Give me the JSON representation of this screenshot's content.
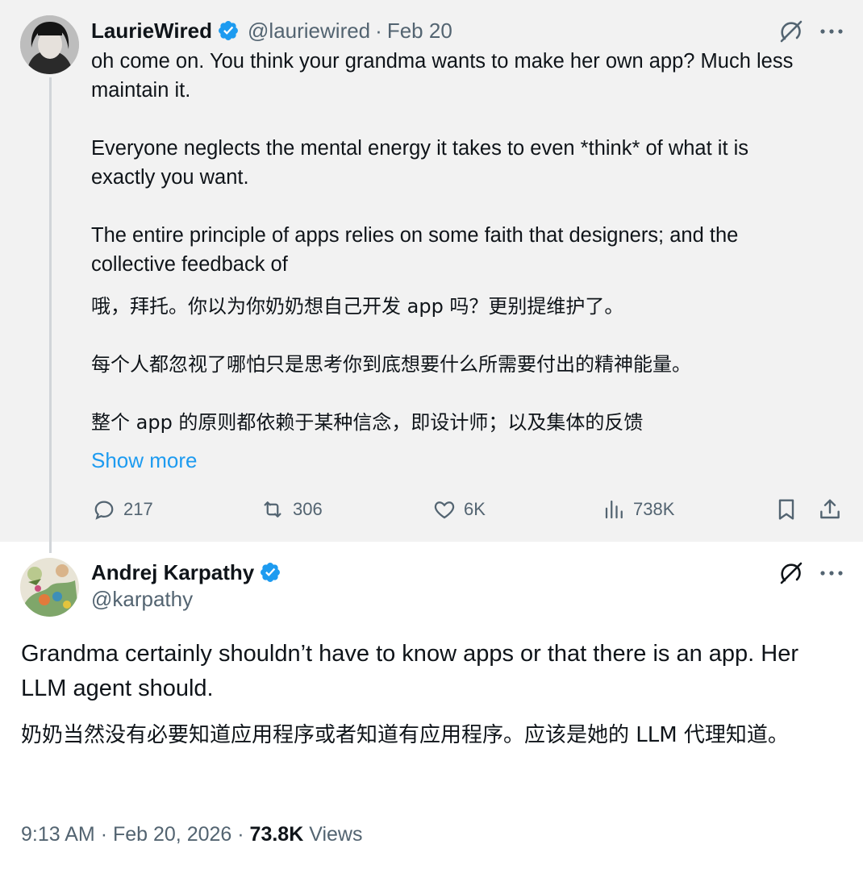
{
  "parent_tweet": {
    "author_name": "LaurieWired",
    "author_handle": "@lauriewired",
    "separator": "·",
    "date": "Feb 20",
    "verified_icon": "verified-badge-icon",
    "text_en": [
      "oh come on. You think your grandma wants to make her own app? Much less maintain it.",
      "Everyone neglects the mental energy it takes to even *think* of what it is exactly you want.",
      "The entire principle of apps relies on some faith that designers; and the collective feedback of"
    ],
    "text_zh": [
      "哦，拜托。你以为你奶奶想自己开发 app 吗？更别提维护了。",
      "每个人都忽视了哪怕只是思考你到底想要什么所需要付出的精神能量。",
      "整个 app 的原则都依赖于某种信念，即设计师；以及集体的反馈"
    ],
    "show_more": "Show more",
    "metrics": {
      "replies": "217",
      "reposts": "306",
      "likes": "6K",
      "views": "738K"
    }
  },
  "main_tweet": {
    "author_name": "Andrej Karpathy",
    "author_handle": "@karpathy",
    "text_en": "Grandma certainly shouldn’t have to know apps or that there is an app. Her LLM agent should.",
    "text_zh": "奶奶当然没有必要知道应用程序或者知道有应用程序。应该是她的 LLM 代理知道。",
    "time": "9:13 AM",
    "separator": "·",
    "date": "Feb 20, 2026",
    "views_count": "73.8K",
    "views_label": "Views"
  },
  "colors": {
    "accent": "#1d9bf0",
    "secondary_text": "#536471",
    "primary_text": "#0f1419",
    "parent_background": "#f2f2f2"
  }
}
